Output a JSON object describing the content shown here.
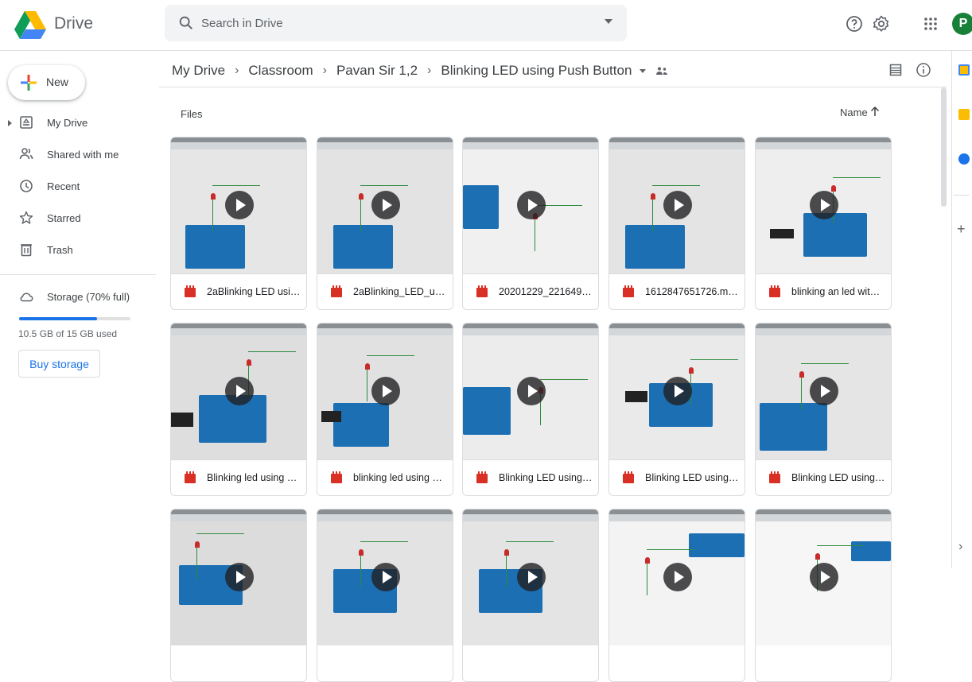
{
  "app": {
    "title": "Drive"
  },
  "search": {
    "placeholder": "Search in Drive"
  },
  "account": {
    "initial": "P",
    "color": "#188038"
  },
  "sidebar": {
    "new_label": "New",
    "items": [
      {
        "label": "My Drive",
        "icon": "my-drive-icon"
      },
      {
        "label": "Shared with me",
        "icon": "shared-icon"
      },
      {
        "label": "Recent",
        "icon": "clock-icon"
      },
      {
        "label": "Starred",
        "icon": "star-icon"
      },
      {
        "label": "Trash",
        "icon": "trash-icon"
      },
      {
        "label": "Storage (70% full)",
        "icon": "cloud-icon"
      }
    ],
    "storage_fraction": 0.7,
    "storage_used": "10.5 GB of 15 GB used",
    "buy_label": "Buy storage"
  },
  "breadcrumb": [
    "My Drive",
    "Classroom",
    "Pavan Sir 1,2",
    "Blinking LED using Push Button"
  ],
  "main": {
    "files_label": "Files",
    "sort_label": "Name"
  },
  "files": [
    {
      "name": "2aBlinking LED using p..."
    },
    {
      "name": "2aBlinking_LED_using_..."
    },
    {
      "name": "20201229_221649.mp4"
    },
    {
      "name": "1612847651726.mp4"
    },
    {
      "name": "blinking an led with pu..."
    },
    {
      "name": "Blinking led using push..."
    },
    {
      "name": "blinking led using push..."
    },
    {
      "name": "Blinking LED using Pus..."
    },
    {
      "name": "Blinking LED using Pus..."
    },
    {
      "name": "Blinking LED using pus..."
    },
    {
      "name": ""
    },
    {
      "name": ""
    },
    {
      "name": ""
    },
    {
      "name": ""
    },
    {
      "name": ""
    }
  ],
  "colors": {
    "accent": "#1a73e8",
    "video_icon": "#d93025"
  }
}
